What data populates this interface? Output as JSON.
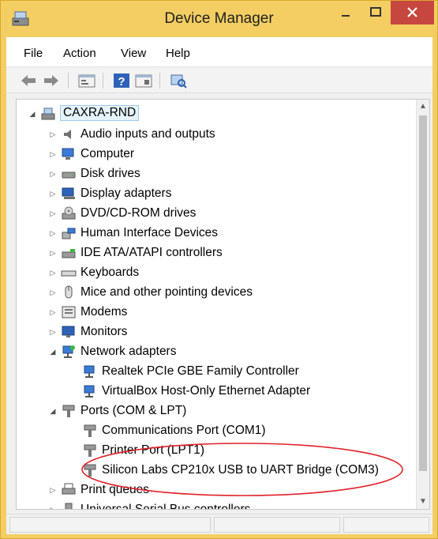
{
  "window": {
    "title": "Device Manager",
    "accent_color": "#f4ce62",
    "close_button_color": "#c7463f"
  },
  "menu": {
    "items": [
      "File",
      "Action",
      "View",
      "Help"
    ]
  },
  "toolbar": {
    "icons": [
      "back-arrow-icon",
      "forward-arrow-icon",
      "properties-icon",
      "help-icon",
      "show-hidden-icon",
      "scan-hardware-icon"
    ]
  },
  "tree": {
    "root": "CAXRA-RND",
    "items": [
      "Audio inputs and outputs",
      "Computer",
      "Disk drives",
      "Display adapters",
      "DVD/CD-ROM drives",
      "Human Interface Devices",
      "IDE ATA/ATAPI controllers",
      "Keyboards",
      "Mice and other pointing devices",
      "Modems",
      "Monitors",
      "Network adapters",
      "Realtek PCIe GBE Family Controller",
      "VirtualBox Host-Only Ethernet Adapter",
      "Ports (COM & LPT)",
      "Communications Port (COM1)",
      "Printer Port (LPT1)",
      "Silicon Labs CP210x USB to UART Bridge (COM3)",
      "Print queues",
      "Universal Serial Bus controllers"
    ],
    "highlight_color": "#e0222a"
  }
}
